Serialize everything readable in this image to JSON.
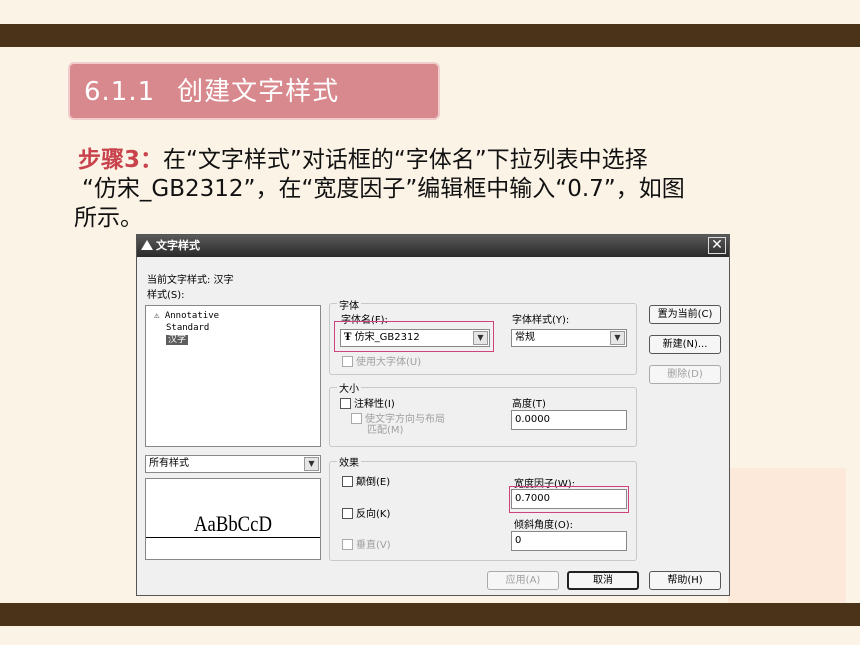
{
  "section": {
    "number": "6.1.1",
    "title": "创建文字样式"
  },
  "step": {
    "lead": "步骤3：",
    "line1": "在“文字样式”对话框的“字体名”下拉列表中选择",
    "line2": "“仿宋_GB2312”，在“宽度因子”编辑框中输入“0.7”，如图",
    "line3": "所示。"
  },
  "dialog": {
    "title": "文字样式",
    "current_style_label": "当前文字样式: 汉字",
    "styles_label": "样式(S):",
    "styles": [
      "Annotative",
      "Standard",
      "汉字"
    ],
    "selected_style_index": 2,
    "filter_value": "所有样式",
    "preview_text": "AaBbCcD",
    "font_group": "字体",
    "font_name_label": "字体名(F):",
    "font_name_value": "仿宋_GB2312",
    "font_style_label": "字体样式(Y):",
    "font_style_value": "常规",
    "big_font_label": "使用大字体(U)",
    "size_group": "大小",
    "annotative_label": "注释性(I)",
    "match_layout_label_1": "使文字方向与布局",
    "match_layout_label_2": "匹配(M)",
    "height_label": "高度(T)",
    "height_value": "0.0000",
    "effects_group": "效果",
    "upside_down_label": "颠倒(E)",
    "backwards_label": "反向(K)",
    "vertical_label": "垂直(V)",
    "width_factor_label": "宽度因子(W):",
    "width_factor_value": "0.7000",
    "oblique_label": "倾斜角度(O):",
    "oblique_value": "0",
    "btn_set_current": "置为当前(C)",
    "btn_new": "新建(N)...",
    "btn_delete": "删除(D)",
    "btn_apply": "应用(A)",
    "btn_cancel": "取消",
    "btn_help": "帮助(H)"
  },
  "colors": {
    "band": "#4a3319",
    "title_bg": "#d8898e",
    "lead_red": "#c9434d",
    "highlight": "#d1427d"
  }
}
